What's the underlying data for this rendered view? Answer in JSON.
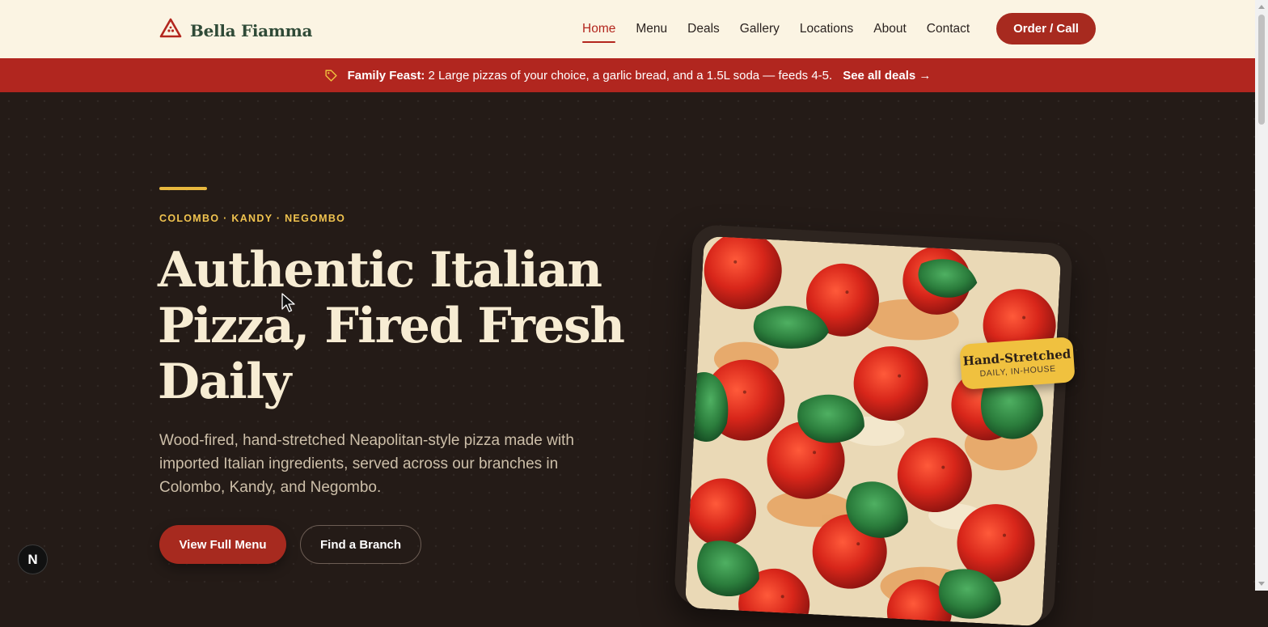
{
  "brand": {
    "name": "Bella Fiamma",
    "logo_icon": "triangle-pizza-icon",
    "color": "#2f4a37"
  },
  "nav": {
    "items": [
      {
        "label": "Home",
        "active": true
      },
      {
        "label": "Menu"
      },
      {
        "label": "Deals"
      },
      {
        "label": "Gallery"
      },
      {
        "label": "Locations"
      },
      {
        "label": "About"
      },
      {
        "label": "Contact"
      }
    ],
    "cta_label": "Order / Call"
  },
  "promo": {
    "icon": "tag-icon",
    "title": "Family Feast:",
    "description": "2 Large pizzas of your choice, a garlic bread, and a 1.5L soda — feeds 4-5.",
    "link_label": "See all deals →"
  },
  "hero": {
    "eyebrow": "COLOMBO · KANDY · NEGOMBO",
    "headline_line1": "Authentic Italian",
    "headline_line2": "Pizza, Fired Fresh",
    "headline_line3": "Daily",
    "subtext": "Wood-fired, hand-stretched Neapolitan-style pizza made with imported Italian ingredients, served across our branches in Colombo, Kandy, and Negombo.",
    "primary_button": "View Full Menu",
    "secondary_button": "Find a Branch",
    "badge_title": "Hand-Stretched",
    "badge_subtitle": "DAILY, IN-HOUSE"
  },
  "dev_badge": "N",
  "colors": {
    "accent_red": "#a72a1f",
    "promo_bar": "#b1261f",
    "hero_bg": "#241b17",
    "header_bg": "#fbf4e3",
    "gold": "#f0c13f"
  }
}
